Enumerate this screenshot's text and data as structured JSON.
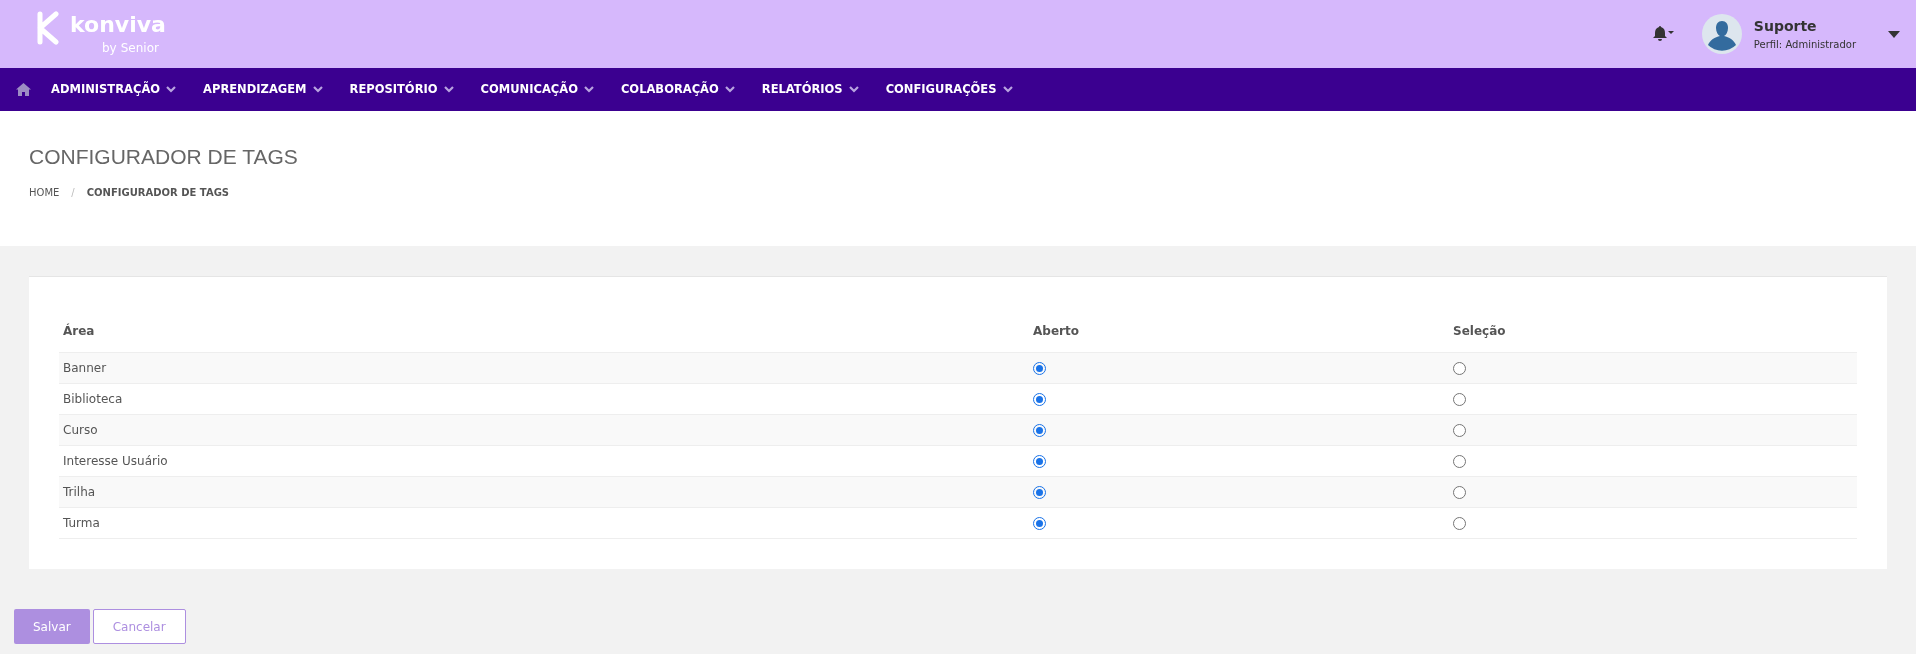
{
  "header": {
    "logo": {
      "name": "konviva",
      "byline": "by",
      "brand": "Senior"
    },
    "user": {
      "name": "Suporte",
      "profile": "Perfil: Administrador"
    }
  },
  "nav": {
    "items": [
      {
        "label": "ADMINISTRAÇÃO"
      },
      {
        "label": "APRENDIZAGEM"
      },
      {
        "label": "REPOSITÓRIO"
      },
      {
        "label": "COMUNICAÇÃO"
      },
      {
        "label": "COLABORAÇÃO"
      },
      {
        "label": "RELATÓRIOS"
      },
      {
        "label": "CONFIGURAÇÕES"
      }
    ]
  },
  "page": {
    "title": "CONFIGURADOR DE TAGS",
    "breadcrumb": [
      "HOME",
      "CONFIGURADOR DE TAGS"
    ],
    "breadcrumb_separator": "/"
  },
  "table": {
    "columns": [
      "Área",
      "Aberto",
      "Seleção"
    ],
    "rows": [
      {
        "area": "Banner",
        "options": [
          {
            "selected": true
          },
          {
            "selected": false
          }
        ]
      },
      {
        "area": "Biblioteca",
        "options": [
          {
            "selected": true
          },
          {
            "selected": false
          }
        ]
      },
      {
        "area": "Curso",
        "options": [
          {
            "selected": true
          },
          {
            "selected": false
          }
        ]
      },
      {
        "area": "Interesse Usuário",
        "options": [
          {
            "selected": true
          },
          {
            "selected": false
          }
        ]
      },
      {
        "area": "Trilha",
        "options": [
          {
            "selected": true
          },
          {
            "selected": false
          }
        ]
      },
      {
        "area": "Turma",
        "options": [
          {
            "selected": true
          },
          {
            "selected": false
          }
        ]
      }
    ]
  },
  "buttons": [
    {
      "label": "Salvar",
      "kind": "primary"
    },
    {
      "label": "Cancelar",
      "kind": "secondary"
    }
  ]
}
